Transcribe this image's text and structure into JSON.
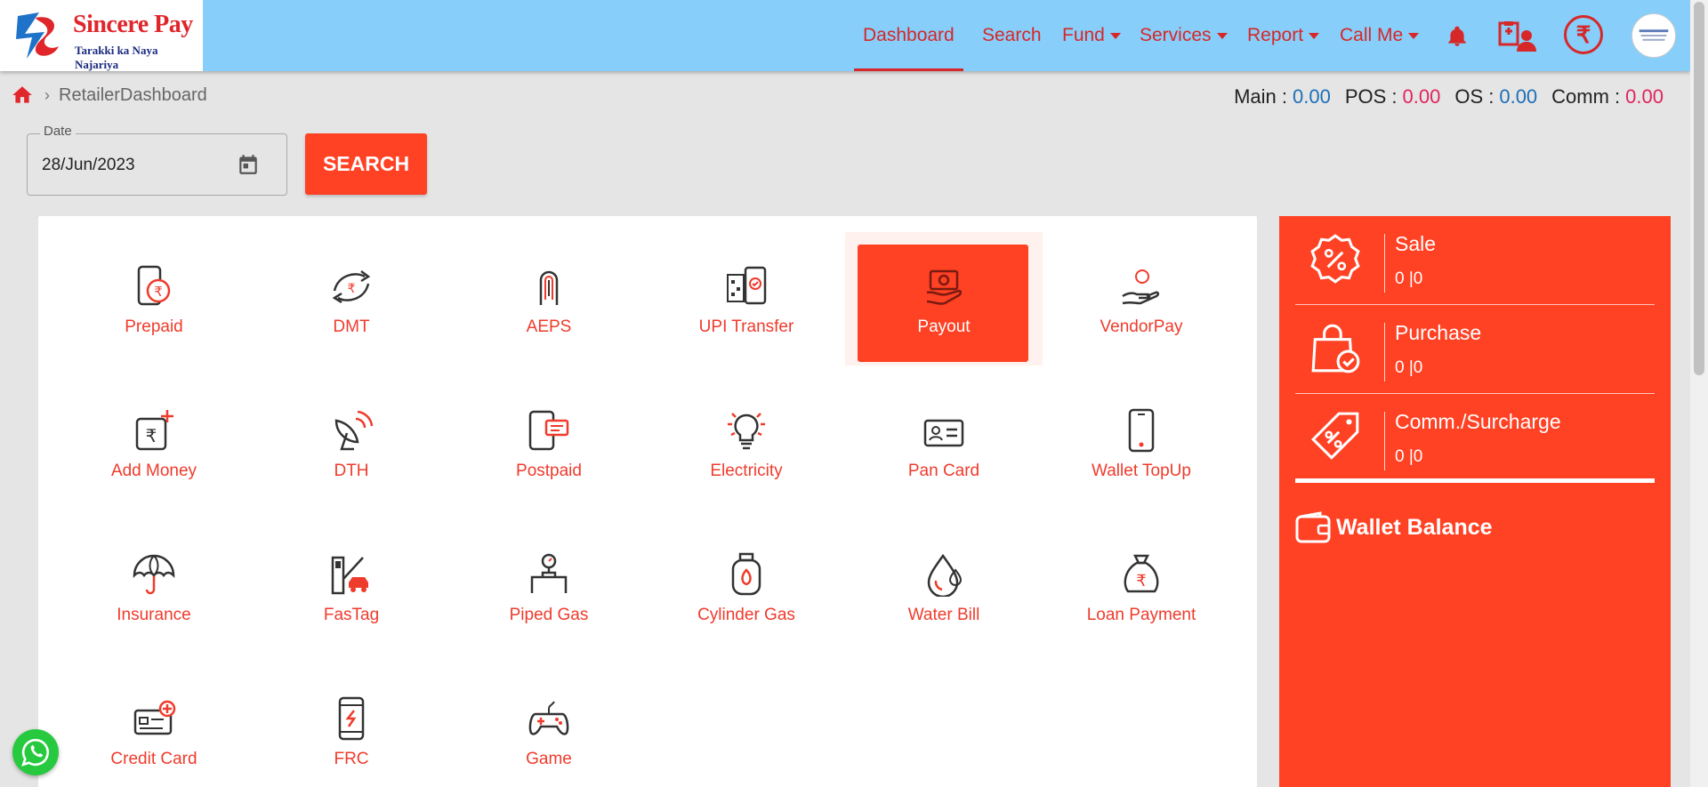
{
  "brand": {
    "name": "Sincere Pay",
    "tagline": "Tarakki ka Naya Najariya"
  },
  "nav": {
    "dashboard": "Dashboard",
    "search": "Search",
    "fund": "Fund",
    "services": "Services",
    "report": "Report",
    "call_me": "Call Me",
    "icons": [
      "bell-icon",
      "support-user-icon",
      "rupee-icon",
      "avatar"
    ]
  },
  "breadcrumb": {
    "page": "RetailerDashboard"
  },
  "balances": {
    "main_label": "Main :",
    "main": "0.00",
    "pos_label": "POS :",
    "pos": "0.00",
    "os_label": "OS :",
    "os": "0.00",
    "comm_label": "Comm :",
    "comm": "0.00"
  },
  "filter": {
    "date_label": "Date",
    "date_value": "28/Jun/2023",
    "search_button": "SEARCH"
  },
  "services": [
    "Prepaid",
    "DMT",
    "AEPS",
    "UPI Transfer",
    "Payout",
    "VendorPay",
    "Add Money",
    "DTH",
    "Postpaid",
    "Electricity",
    "Pan Card",
    "Wallet TopUp",
    "Insurance",
    "FasTag",
    "Piped Gas",
    "Cylinder Gas",
    "Water Bill",
    "Loan Payment",
    "Credit Card",
    "FRC",
    "Game"
  ],
  "selected_service": "Payout",
  "stats": [
    {
      "title": "Sale",
      "value": "0 |0"
    },
    {
      "title": "Purchase",
      "value": "0 |0"
    },
    {
      "title": "Comm./Surcharge",
      "value": "0 |0"
    }
  ],
  "wallet": {
    "title": "Wallet Balance"
  },
  "colors": {
    "accent": "#ff4124",
    "header": "#87cefa",
    "nav_text": "#d62828",
    "blue_value": "#1d6fb8",
    "pink_value": "#e0245e"
  }
}
